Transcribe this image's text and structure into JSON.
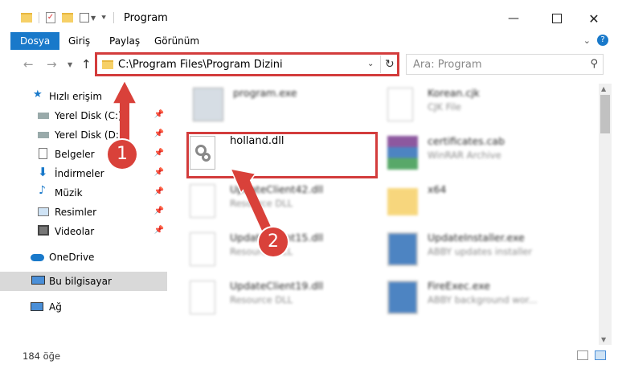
{
  "window": {
    "title": "Program"
  },
  "ribbon": {
    "tabs": [
      "Dosya",
      "Giriş",
      "Paylaş",
      "Görünüm"
    ]
  },
  "address": {
    "path": "C:\\Program Files\\Program Dizini"
  },
  "search": {
    "placeholder": "Ara: Program"
  },
  "sidebar": {
    "items": [
      {
        "label": "Hızlı erişim",
        "icon": "star-icon",
        "pinned": false
      },
      {
        "label": "Yerel Disk (C:)",
        "icon": "drive-icon",
        "pinned": true
      },
      {
        "label": "Yerel Disk (D:)",
        "icon": "drive-icon",
        "pinned": true
      },
      {
        "label": "Belgeler",
        "icon": "documents-icon",
        "pinned": true
      },
      {
        "label": "İndirmeler",
        "icon": "download-icon",
        "pinned": true
      },
      {
        "label": "Müzik",
        "icon": "music-icon",
        "pinned": true
      },
      {
        "label": "Resimler",
        "icon": "pictures-icon",
        "pinned": true
      },
      {
        "label": "Videolar",
        "icon": "videos-icon",
        "pinned": true
      },
      {
        "label": "OneDrive",
        "icon": "cloud-icon",
        "pinned": false
      },
      {
        "label": "Bu bilgisayar",
        "icon": "computer-icon",
        "pinned": false
      },
      {
        "label": "Ağ",
        "icon": "network-icon",
        "pinned": false
      }
    ]
  },
  "files": [
    {
      "name": "program.exe",
      "type": ""
    },
    {
      "name": "Korean.cjk",
      "type": "CJK File"
    },
    {
      "name": "holland.dll",
      "type": ""
    },
    {
      "name": "certificates.cab",
      "type": "WinRAR Archive"
    },
    {
      "name": "UpdateClient42.dll",
      "type": "Resource DLL"
    },
    {
      "name": "x64",
      "type": ""
    },
    {
      "name": "UpdateClient15.dll",
      "type": "Resource DLL"
    },
    {
      "name": "UpdateInstaller.exe",
      "type": "ABBY updates installer"
    },
    {
      "name": "UpdateClient19.dll",
      "type": "Resource DLL"
    },
    {
      "name": "FireExec.exe",
      "type": "ABBY background wor..."
    }
  ],
  "status": {
    "count": "184 öğe"
  },
  "annotations": {
    "step1": "1",
    "step2": "2"
  },
  "colors": {
    "accent": "#1979ca",
    "highlight": "#d33c3c",
    "badge": "#d9413a"
  }
}
